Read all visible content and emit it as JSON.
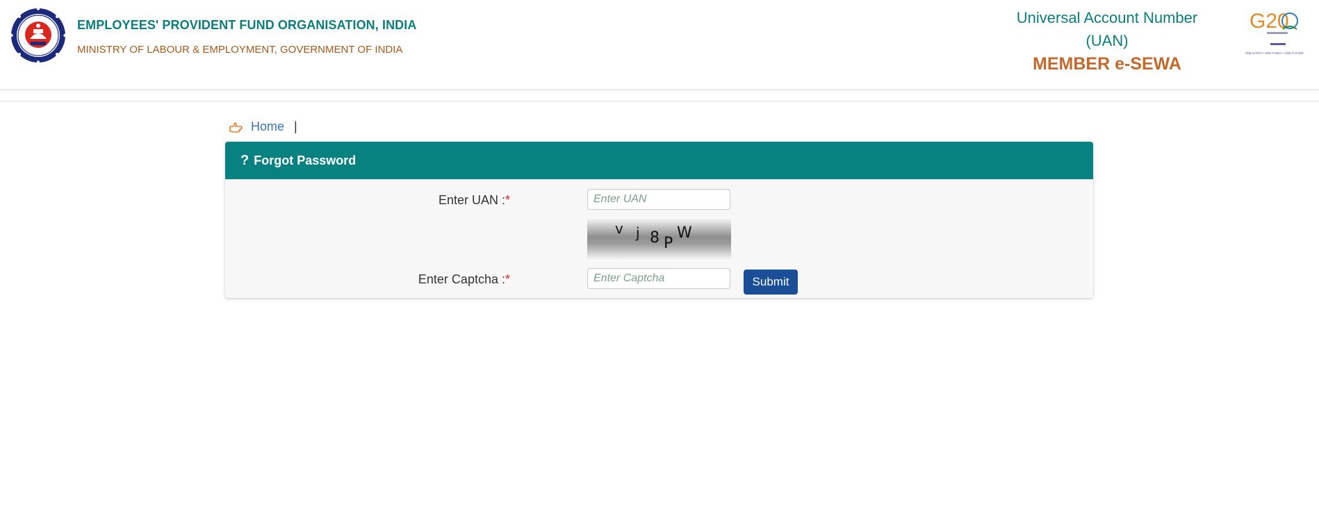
{
  "header": {
    "org_name": "EMPLOYEES' PROVIDENT FUND ORGANISATION, INDIA",
    "ministry": "MINISTRY OF LABOUR & EMPLOYMENT, GOVERNMENT OF INDIA",
    "uan_line1": "Universal Account Number",
    "uan_line2": "(UAN)",
    "member_esewa": "MEMBER e-SEWA",
    "g20_text": "G20",
    "g20_tagline": "ONE EARTH • ONE FAMILY • ONE FUTURE"
  },
  "breadcrumb": {
    "icon": "hand-pointing-icon",
    "home_label": "Home",
    "separator": "|"
  },
  "panel": {
    "title_icon": "question-mark-icon",
    "title": "Forgot Password",
    "uan_label": "Enter UAN :",
    "uan_placeholder": "Enter UAN",
    "uan_value": "",
    "captcha_text": "vj8PW",
    "captcha_label": "Enter Captcha :",
    "captcha_placeholder": "Enter Captcha",
    "captcha_value": "",
    "required_mark": "*",
    "submit_label": "Submit"
  },
  "colors": {
    "teal": "#078280",
    "orange": "#c4692c",
    "submit_blue": "#1a4e96",
    "link_blue": "#3a73b5",
    "required_red": "#d9241f"
  }
}
